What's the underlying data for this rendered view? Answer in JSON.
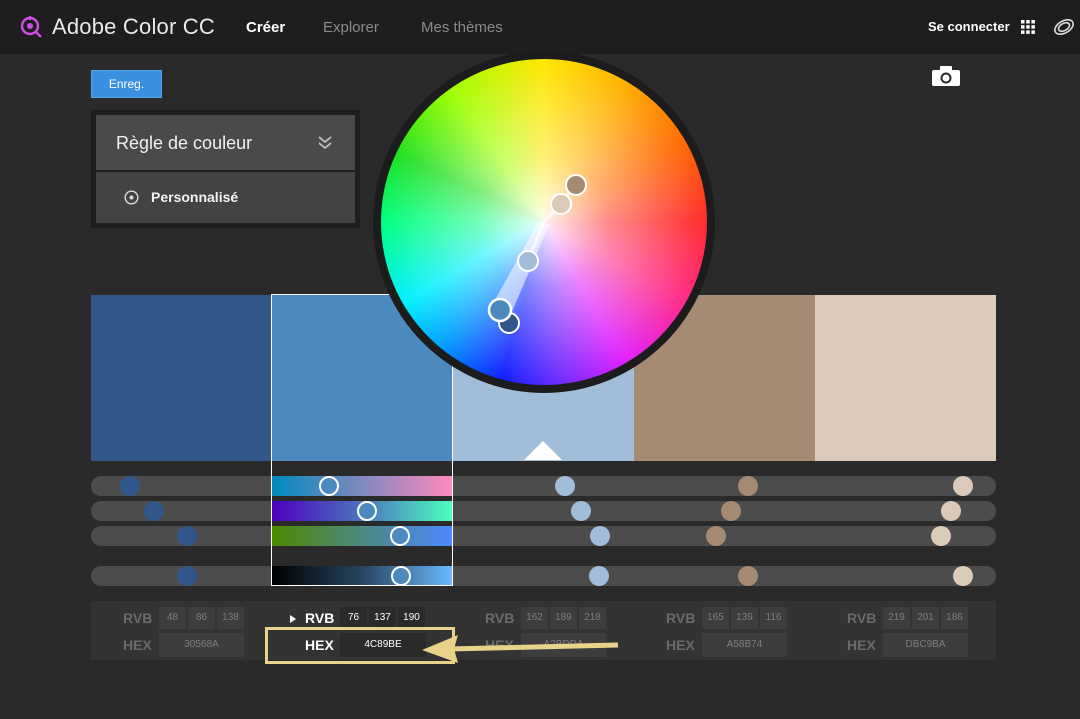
{
  "app": {
    "title": "Adobe Color CC",
    "logo_icon": "color-wheel-logo-icon"
  },
  "nav": [
    {
      "label": "Créer",
      "active": true
    },
    {
      "label": "Explorer",
      "active": false
    },
    {
      "label": "Mes thèmes",
      "active": false
    }
  ],
  "header_right": {
    "signin_label": "Se connecter",
    "apps_icon": "grid-apps-icon",
    "cc_icon": "creative-cloud-icon"
  },
  "toolbar": {
    "save_label": "Enreg.",
    "camera_icon": "camera-icon"
  },
  "color_rule": {
    "title": "Règle de couleur",
    "selected_option": "Personnalisé"
  },
  "swatches": [
    {
      "color": "#30568A",
      "hex": "30568A",
      "r": "48",
      "g": "86",
      "b": "138",
      "selected": false
    },
    {
      "color": "#4C89BE",
      "hex": "4C89BE",
      "r": "76",
      "g": "137",
      "b": "190",
      "selected": true
    },
    {
      "color": "#A2BDDA",
      "hex": "A2BDDA",
      "r": "162",
      "g": "189",
      "b": "218",
      "selected": false
    },
    {
      "color": "#A58B74",
      "hex": "A58B74",
      "r": "165",
      "g": "139",
      "b": "116",
      "selected": false
    },
    {
      "color": "#DBC9BA",
      "hex": "DBC9BA",
      "r": "219",
      "g": "201",
      "b": "186",
      "selected": false
    }
  ],
  "labels": {
    "rgb": "RVB",
    "hex": "HEX"
  },
  "accent": {
    "highlight": "#e9d28a",
    "save_button": "#3a8fe0"
  }
}
